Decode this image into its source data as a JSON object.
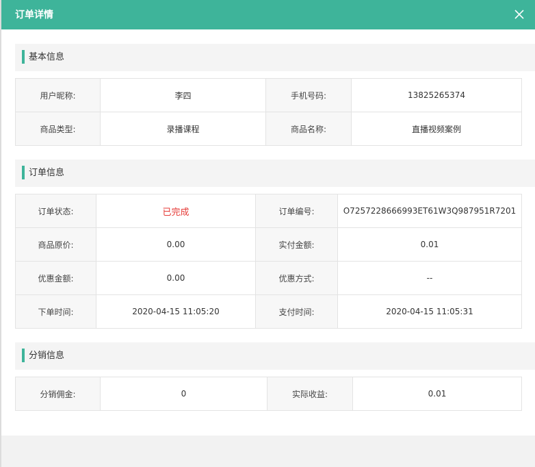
{
  "modal": {
    "title": "订单详情"
  },
  "basic": {
    "title": "基本信息",
    "rows": [
      {
        "label1": "用户昵称:",
        "value1": "李四",
        "label2": "手机号码:",
        "value2": "13825265374"
      },
      {
        "label1": "商品类型:",
        "value1": "录播课程",
        "label2": "商品名称:",
        "value2": "直播视频案例"
      }
    ]
  },
  "order": {
    "title": "订单信息",
    "rows": [
      {
        "label1": "订单状态:",
        "value1": "已完成",
        "label2": "订单编号:",
        "value2": "O7257228666993ET61W3Q987951R7201"
      },
      {
        "label1": "商品原价:",
        "value1": "0.00",
        "label2": "实付金额:",
        "value2": "0.01"
      },
      {
        "label1": "优惠金额:",
        "value1": "0.00",
        "label2": "优惠方式:",
        "value2": "--"
      },
      {
        "label1": "下单时间:",
        "value1": "2020-04-15 11:05:20",
        "label2": "支付时间:",
        "value2": "2020-04-15 11:05:31"
      }
    ],
    "status_color": "#e53935"
  },
  "distribution": {
    "title": "分销信息",
    "rows": [
      {
        "label1": "分销佣金:",
        "value1": "0",
        "label2": "实际收益:",
        "value2": "0.01"
      }
    ]
  },
  "colors": {
    "accent": "#3eb49a"
  },
  "icons": {
    "close": "close-icon"
  }
}
